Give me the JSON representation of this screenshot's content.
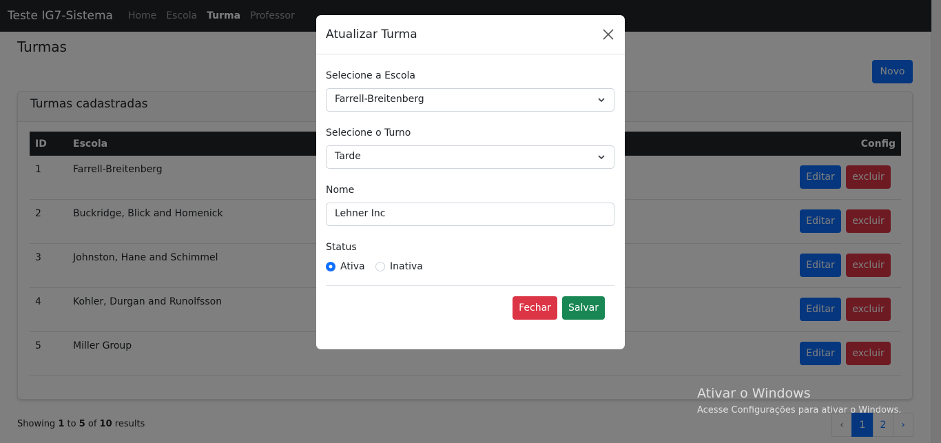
{
  "navbar": {
    "brand": "Teste IG7-Sistema",
    "links": [
      "Home",
      "Escola",
      "Turma",
      "Professor"
    ]
  },
  "page": {
    "title": "Turmas",
    "new_button": "Novo"
  },
  "card": {
    "title": "Turmas cadastradas",
    "columns": {
      "id": "ID",
      "escola": "Escola",
      "config": "Config"
    },
    "rows": [
      {
        "id": "1",
        "escola": "Farrell-Breitenberg",
        "edit": "Editar",
        "delete": "excluir"
      },
      {
        "id": "2",
        "escola": "Buckridge, Blick and Homenick",
        "edit": "Editar",
        "delete": "excluir"
      },
      {
        "id": "3",
        "escola": "Johnston, Hane and Schimmel",
        "edit": "Editar",
        "delete": "excluir"
      },
      {
        "id": "4",
        "escola": "Kohler, Durgan and Runolfsson",
        "edit": "Editar",
        "delete": "excluir"
      },
      {
        "id": "5",
        "escola": "Miller Group",
        "edit": "Editar",
        "delete": "excluir"
      }
    ]
  },
  "pagination": {
    "showing_prefix": "Showing ",
    "from": "1",
    "to_word": " to ",
    "to": "5",
    "of_word": " of ",
    "total": "10",
    "suffix": " results",
    "prev": "‹",
    "pages": [
      "1",
      "2"
    ],
    "next": "›"
  },
  "modal": {
    "title": "Atualizar Turma",
    "escola_label": "Selecione a Escola",
    "escola_value": "Farrell-Breitenberg",
    "turno_label": "Selecione o Turno",
    "turno_value": "Tarde",
    "nome_label": "Nome",
    "nome_value": "Lehner Inc",
    "status_label": "Status",
    "status_options": [
      "Ativa",
      "Inativa"
    ],
    "status_selected": "Ativa",
    "close_button": "Fechar",
    "save_button": "Salvar"
  },
  "watermark": {
    "line1": "Ativar o Windows",
    "line2": "Acesse Configurações para ativar o Windows."
  },
  "colors": {
    "primary": "#0d6efd",
    "danger": "#dc3545",
    "success": "#198754",
    "dark": "#212529"
  }
}
